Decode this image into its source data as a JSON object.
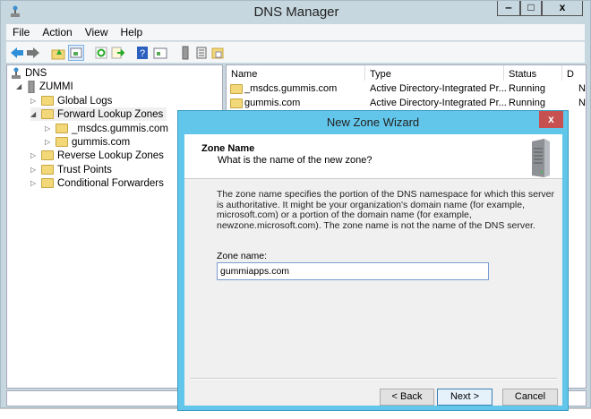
{
  "window": {
    "title": "DNS Manager",
    "controls": [
      "minimize",
      "maximize",
      "close"
    ]
  },
  "menu": [
    "File",
    "Action",
    "View",
    "Help"
  ],
  "toolbar": [
    "back-icon",
    "forward-icon",
    "up-folder-icon",
    "show-hide-tree-icon",
    "refresh-icon",
    "export-icon",
    "help-icon",
    "show-action-pane-icon",
    "server-icon",
    "list-icon",
    "zone-icon"
  ],
  "tree": {
    "root": "DNS",
    "server": "ZUMMI",
    "items": [
      {
        "label": "Global Logs",
        "level": 2,
        "expanded": false
      },
      {
        "label": "Forward Lookup Zones",
        "level": 2,
        "expanded": true,
        "selected": true
      },
      {
        "label": "_msdcs.gummis.com",
        "level": 3,
        "expanded": false
      },
      {
        "label": "gummis.com",
        "level": 3,
        "expanded": false
      },
      {
        "label": "Reverse Lookup Zones",
        "level": 2,
        "expanded": false
      },
      {
        "label": "Trust Points",
        "level": 2,
        "expanded": false
      },
      {
        "label": "Conditional Forwarders",
        "level": 2,
        "expanded": false
      }
    ]
  },
  "list": {
    "columns": [
      "Name",
      "Type",
      "Status",
      "D"
    ],
    "rows": [
      [
        "_msdcs.gummis.com",
        "Active Directory-Integrated Pr...",
        "Running",
        "N"
      ],
      [
        "gummis.com",
        "Active Directory-Integrated Pr...",
        "Running",
        "N"
      ]
    ]
  },
  "dialog": {
    "title": "New Zone Wizard",
    "close": "x",
    "heading": "Zone Name",
    "subheading": "What is the name of the new zone?",
    "description": "The zone name specifies the portion of the DNS namespace for which this server is authoritative. It might be your organization's domain name (for example,  microsoft.com) or a portion of the domain name (for example, newzone.microsoft.com). The zone name is not the name of the DNS server.",
    "field_label": "Zone name:",
    "field_value": "gummiapps.com",
    "back": "< Back",
    "next": "Next >",
    "cancel": "Cancel",
    "accent": "#62c6ea",
    "close_color": "#c75050"
  }
}
